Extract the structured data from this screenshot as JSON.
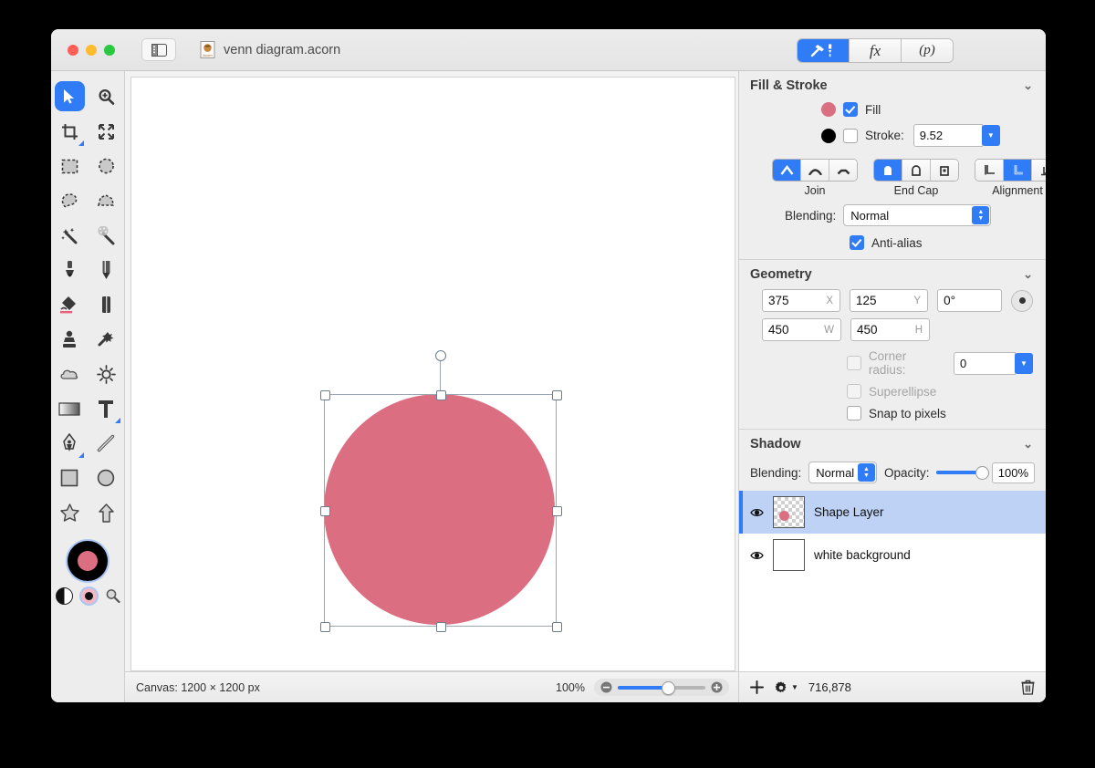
{
  "window": {
    "document_title": "venn diagram.acorn",
    "doc_icon": "acorn-document-icon",
    "sidebar_toggle_icon": "sidebar-toggle-icon",
    "traffic_lights": [
      "close-button",
      "minimize-button",
      "zoom-button"
    ]
  },
  "inspector_tabs": [
    {
      "name": "tools-tab",
      "label": "",
      "icon": "hammer-pen-icon",
      "selected": true
    },
    {
      "name": "effects-tab",
      "label": "fx",
      "icon": "fx-icon",
      "selected": false
    },
    {
      "name": "palette-tab",
      "label": "(p)",
      "icon": "palette-icon",
      "selected": false
    }
  ],
  "tools": [
    {
      "name": "move-tool",
      "icon": "cursor-arrow-icon",
      "selected": true
    },
    {
      "name": "zoom-tool",
      "icon": "magnifier-plus-icon",
      "selected": false
    },
    {
      "name": "crop-tool",
      "icon": "crop-icon",
      "selected": false,
      "badge": true
    },
    {
      "name": "transform-tool",
      "icon": "move-arrows-icon",
      "selected": false
    },
    {
      "name": "rectangular-select-tool",
      "icon": "dashed-rectangle-icon",
      "selected": false
    },
    {
      "name": "elliptical-select-tool",
      "icon": "dashed-ellipse-icon",
      "selected": false
    },
    {
      "name": "lasso-tool",
      "icon": "lasso-icon",
      "selected": false
    },
    {
      "name": "polygon-lasso-tool",
      "icon": "polygon-lasso-icon",
      "selected": false
    },
    {
      "name": "magic-wand-tool",
      "icon": "magic-wand-icon",
      "selected": false
    },
    {
      "name": "instant-alpha-tool",
      "icon": "magic-wand-dots-icon",
      "selected": false
    },
    {
      "name": "brush-tool",
      "icon": "paintbrush-icon",
      "selected": false
    },
    {
      "name": "pencil-tool",
      "icon": "pencil-icon",
      "selected": false
    },
    {
      "name": "paint-bucket-tool",
      "icon": "paint-bucket-icon",
      "selected": false
    },
    {
      "name": "eraser-tool",
      "icon": "eraser-icon",
      "selected": false
    },
    {
      "name": "clone-stamp-tool",
      "icon": "clone-stamp-icon",
      "selected": false
    },
    {
      "name": "smudge-tool",
      "icon": "smudge-splatter-icon",
      "selected": false
    },
    {
      "name": "blur-tool",
      "icon": "cloud-blur-icon",
      "selected": false
    },
    {
      "name": "dodge-tool",
      "icon": "sun-dodge-icon",
      "selected": false
    },
    {
      "name": "gradient-tool",
      "icon": "gradient-icon",
      "selected": false
    },
    {
      "name": "text-tool",
      "icon": "text-t-icon",
      "selected": false,
      "badge": true
    },
    {
      "name": "pen-tool",
      "icon": "pen-nib-icon",
      "selected": false,
      "badge": true
    },
    {
      "name": "line-tool",
      "icon": "line-icon",
      "selected": false
    },
    {
      "name": "rectangle-tool",
      "icon": "rectangle-icon",
      "selected": false
    },
    {
      "name": "ellipse-tool",
      "icon": "ellipse-icon",
      "selected": false
    },
    {
      "name": "star-tool",
      "icon": "star-icon",
      "selected": false
    },
    {
      "name": "arrow-tool",
      "icon": "arrow-up-icon",
      "selected": false
    }
  ],
  "color_well": {
    "stroke_color": "#000000",
    "fill_color": "#db6e81",
    "mini_icons": [
      "black-white-reset-icon",
      "foreground-color-dot-icon",
      "color-picker-icon"
    ]
  },
  "canvas": {
    "size_label": "Canvas: 1200 × 1200 px",
    "zoom_label": "100%",
    "zoom_minus_icon": "zoom-out-icon",
    "zoom_plus_icon": "zoom-in-icon",
    "shape_fill": "#db6e81",
    "background": "#ffffff"
  },
  "fill_stroke": {
    "title": "Fill & Stroke",
    "fill_label": "Fill",
    "fill_checked": true,
    "fill_color": "#db6e81",
    "stroke_label": "Stroke:",
    "stroke_checked": false,
    "stroke_color": "#000000",
    "stroke_width": "9.52",
    "join_label": "Join",
    "join_options": [
      "miter-join-icon",
      "round-join-icon",
      "bevel-join-icon"
    ],
    "join_selected": 0,
    "endcap_label": "End Cap",
    "endcap_options": [
      "butt-cap-icon",
      "round-cap-icon",
      "square-cap-icon"
    ],
    "endcap_selected": 0,
    "alignment_label": "Alignment",
    "alignment_options": [
      "align-inside-icon",
      "align-center-icon",
      "align-outside-icon"
    ],
    "alignment_selected": 1,
    "blending_label": "Blending:",
    "blending_value": "Normal",
    "antialias_label": "Anti-alias",
    "antialias_checked": true
  },
  "geometry": {
    "title": "Geometry",
    "x_value": "375",
    "x_label": "X",
    "y_value": "125",
    "y_label": "Y",
    "rotation_value": "0°",
    "w_value": "450",
    "w_label": "W",
    "h_value": "450",
    "h_label": "H",
    "corner_radius_label": "Corner radius:",
    "corner_radius_value": "0",
    "corner_radius_checked": false,
    "superellipse_label": "Superellipse",
    "superellipse_checked": false,
    "snap_label": "Snap to pixels",
    "snap_checked": false
  },
  "shadow": {
    "title": "Shadow",
    "blending_label": "Blending:",
    "blending_value": "Normal",
    "opacity_label": "Opacity:",
    "opacity_value": "100%"
  },
  "layers": {
    "items": [
      {
        "name": "Shape Layer",
        "selected": true,
        "visible": true,
        "thumb": "checker-pink-circle"
      },
      {
        "name": "white background",
        "selected": false,
        "visible": true,
        "thumb": "white"
      }
    ],
    "toolbar": {
      "add_icon": "plus-icon",
      "settings_icon": "gear-dropdown-icon",
      "count": "716,878",
      "delete_icon": "trash-icon"
    }
  }
}
